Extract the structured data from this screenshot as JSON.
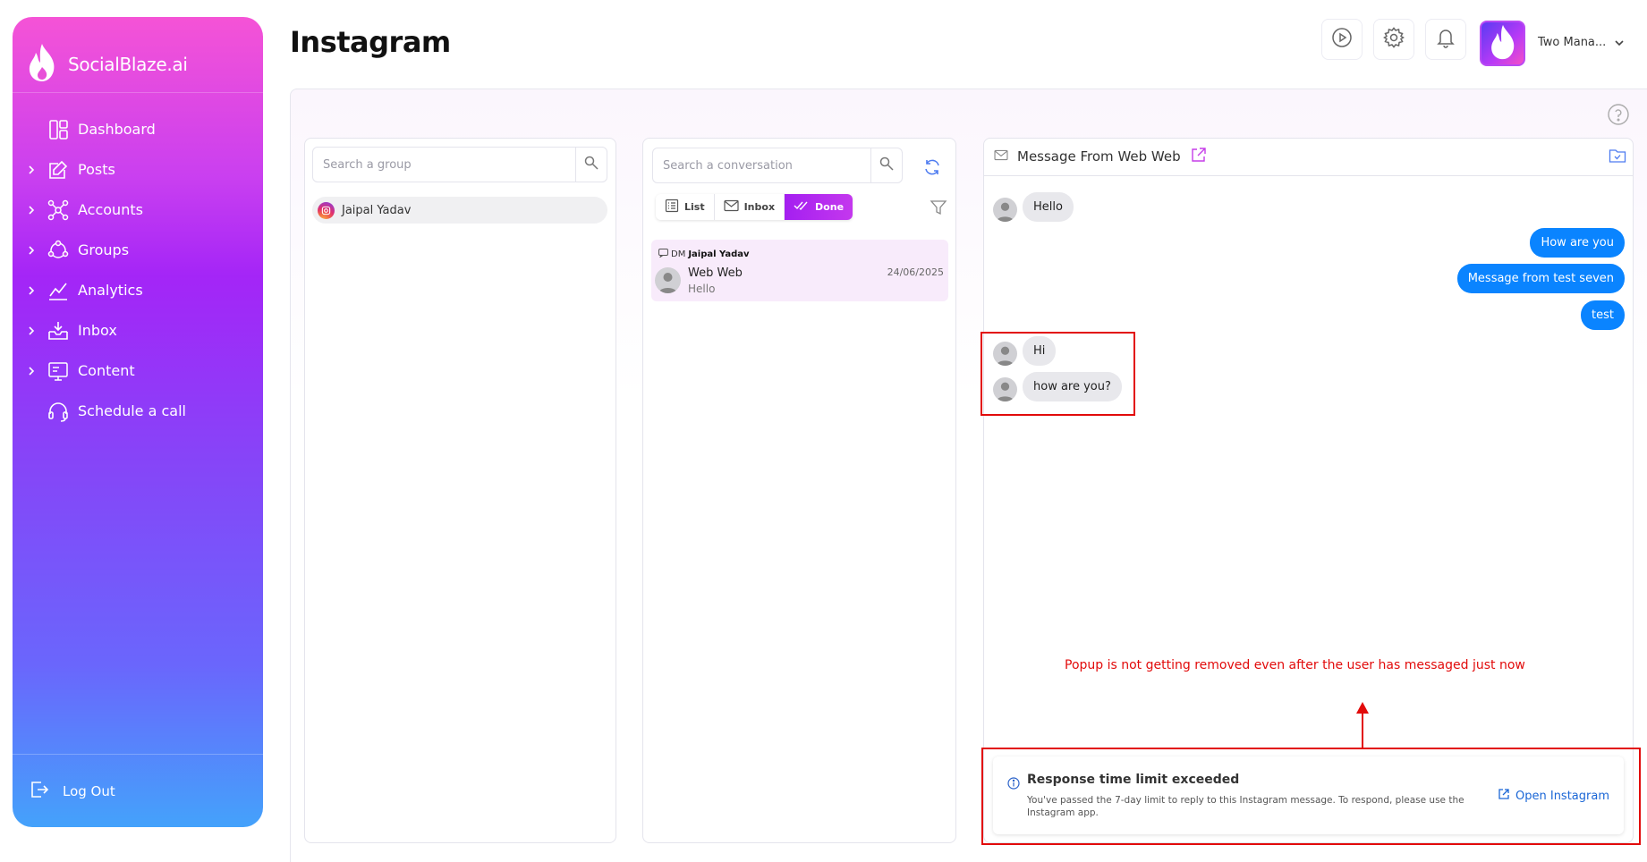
{
  "sidebar": {
    "brand": "SocialBlaze.ai",
    "items": [
      {
        "label": "Dashboard",
        "icon": "dashboard-icon",
        "expandable": false
      },
      {
        "label": "Posts",
        "icon": "posts-icon",
        "expandable": true
      },
      {
        "label": "Accounts",
        "icon": "accounts-icon",
        "expandable": true
      },
      {
        "label": "Groups",
        "icon": "groups-icon",
        "expandable": true
      },
      {
        "label": "Analytics",
        "icon": "analytics-icon",
        "expandable": true
      },
      {
        "label": "Inbox",
        "icon": "inbox-icon",
        "expandable": true
      },
      {
        "label": "Content",
        "icon": "content-icon",
        "expandable": true
      },
      {
        "label": "Schedule a call",
        "icon": "headset-icon",
        "expandable": false
      }
    ],
    "logout": "Log Out"
  },
  "header": {
    "title": "Instagram",
    "account_name": "Two Mana..."
  },
  "groups": {
    "search_placeholder": "Search a group",
    "items": [
      {
        "name": "Jaipal Yadav"
      }
    ]
  },
  "conversations": {
    "search_placeholder": "Search a conversation",
    "tabs": [
      {
        "label": "List",
        "active": false
      },
      {
        "label": "Inbox",
        "active": false
      },
      {
        "label": "Done",
        "active": true
      }
    ],
    "items": [
      {
        "type": "DM",
        "group": "Jaipal Yadav",
        "name": "Web Web",
        "preview": "Hello",
        "date": "24/06/2025"
      }
    ]
  },
  "messages": {
    "header": "Message From Web Web",
    "thread": [
      {
        "dir": "in",
        "text": "Hello"
      },
      {
        "dir": "out",
        "text": "How are you"
      },
      {
        "dir": "out",
        "text": "Message from test seven"
      },
      {
        "dir": "out",
        "text": "test"
      },
      {
        "dir": "in",
        "text": "Hi"
      },
      {
        "dir": "in",
        "text": "how are you?"
      }
    ]
  },
  "annotation": "Popup is not getting removed even after the user has messaged just now",
  "alert": {
    "title": "Response time limit exceeded",
    "body": "You've passed the 7-day limit to reply to this Instagram message. To respond, please use the Instagram app.",
    "link": "Open Instagram"
  },
  "colors": {
    "accent": "#a41ff0",
    "outgoing_bubble": "#0a84ff",
    "annotation_red": "#e20b0b"
  }
}
